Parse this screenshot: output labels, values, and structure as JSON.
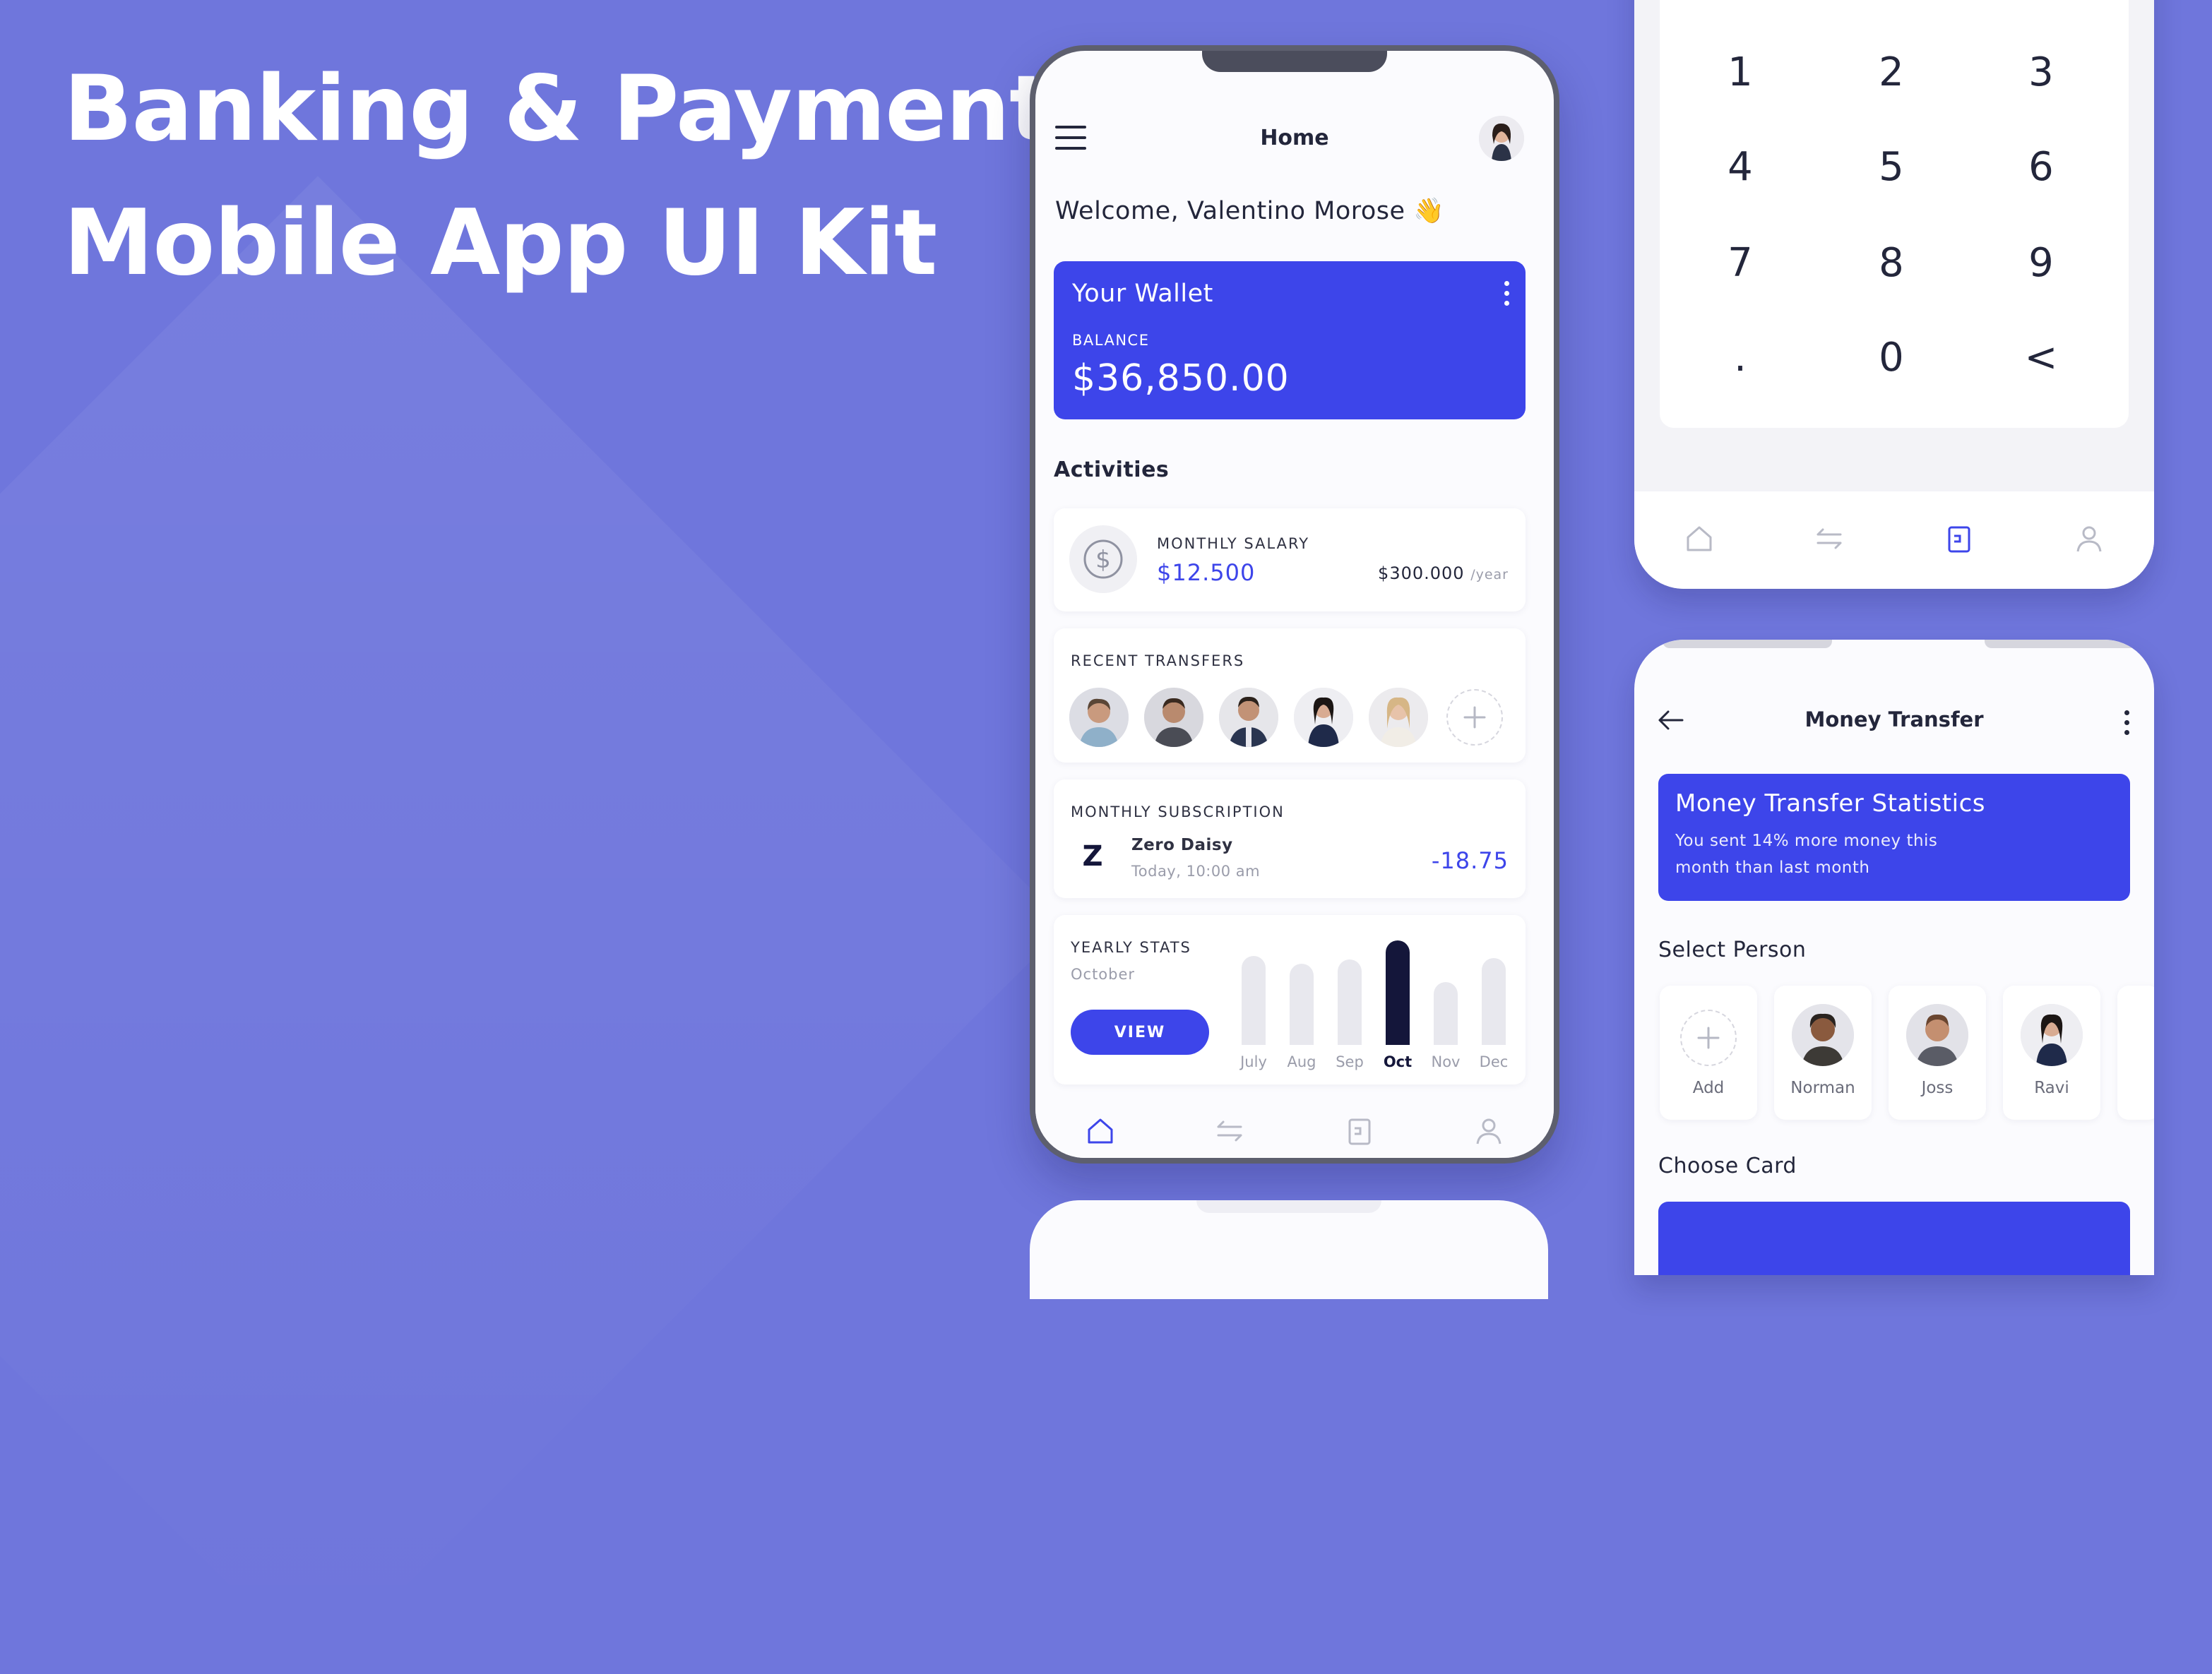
{
  "hero": {
    "line1": "Banking & Payment",
    "line2": "Mobile App UI Kit"
  },
  "home": {
    "title": "Home",
    "welcome": "Welcome, Valentino Morose 👋",
    "wallet": {
      "title": "Your Wallet",
      "balance_label": "BALANCE",
      "balance": "$36,850.00"
    },
    "activities_title": "Activities",
    "salary": {
      "label": "MONTHLY SALARY",
      "value": "$12.500",
      "yearly": "$300.000",
      "yearly_unit": "/year"
    },
    "recent_transfers_label": "RECENT TRANSFERS",
    "subscription": {
      "label": "MONTHLY SUBSCRIPTION",
      "name": "Zero Daisy",
      "time": "Today, 10:00 am",
      "amount": "-18.75",
      "logo_letter": "Z"
    },
    "yearly_stats": {
      "label": "YEARLY STATS",
      "month": "October",
      "view_button": "VIEW"
    }
  },
  "chart_data": {
    "type": "bar",
    "categories": [
      "July",
      "Aug",
      "Sep",
      "Oct",
      "Nov",
      "Dec"
    ],
    "values": [
      0.85,
      0.78,
      0.82,
      1.0,
      0.6,
      0.83
    ],
    "highlight": "Oct",
    "colors": {
      "default": "#e8e8ee",
      "highlight": "#14163a"
    }
  },
  "keypad": {
    "keys": [
      "1",
      "2",
      "3",
      "4",
      "5",
      "6",
      "7",
      "8",
      "9",
      ".",
      "0",
      "<"
    ]
  },
  "transfer": {
    "title": "Money Transfer",
    "stat_title": "Money Transfer Statistics",
    "stat_line1": "You sent 14% more money this",
    "stat_line2": "month than last month",
    "select_person": "Select Person",
    "people": [
      {
        "name": "Add"
      },
      {
        "name": "Norman"
      },
      {
        "name": "Joss"
      },
      {
        "name": "Ravi"
      }
    ],
    "choose_card": "Choose Card"
  },
  "colors": {
    "accent": "#3d45ea",
    "background": "#6f76dc",
    "text": "#23263b"
  }
}
